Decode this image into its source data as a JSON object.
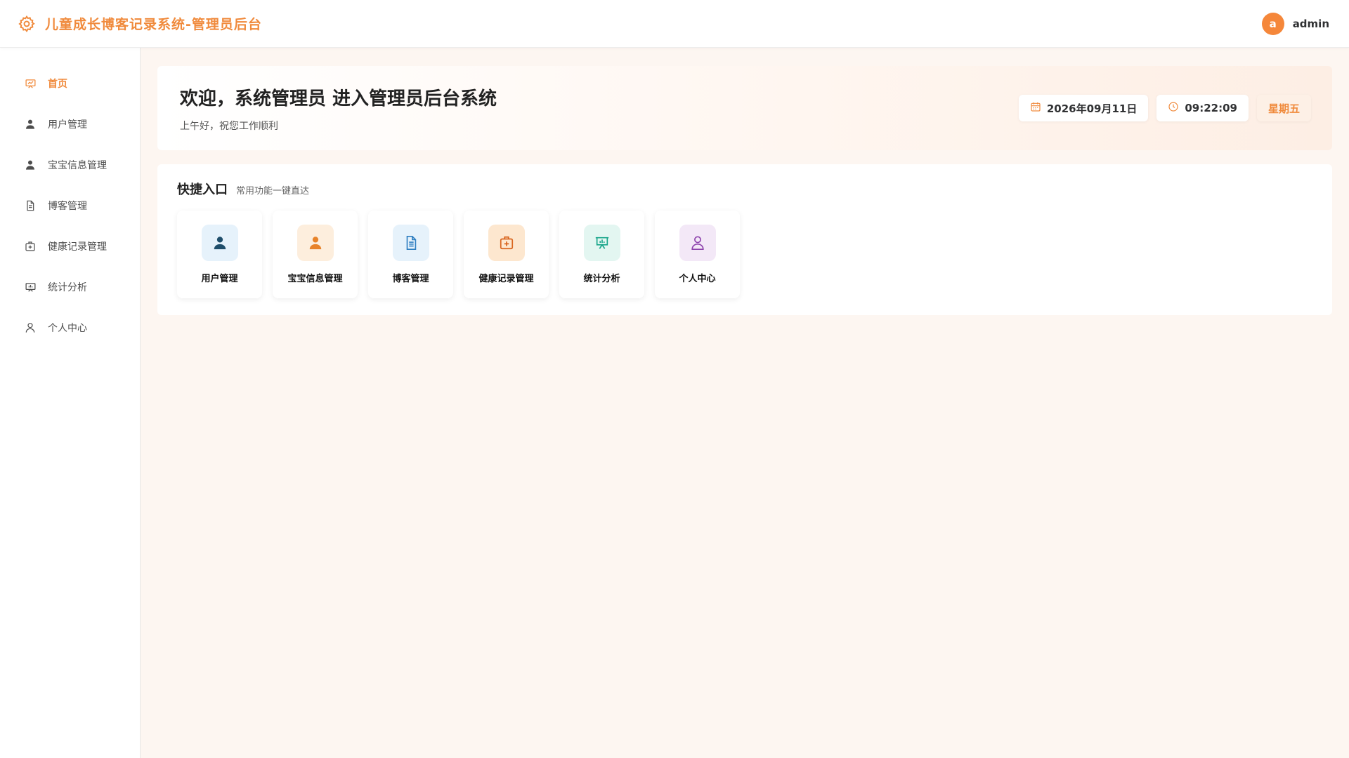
{
  "header": {
    "title": "儿童成长博客记录系统-管理员后台",
    "brand_icon": "gear-icon",
    "avatar_letter": "a",
    "username": "admin",
    "accent": "#f08a3c"
  },
  "sidebar": {
    "items": [
      {
        "label": "首页",
        "icon": "presentation-icon",
        "active": true
      },
      {
        "label": "用户管理",
        "icon": "user-icon"
      },
      {
        "label": "宝宝信息管理",
        "icon": "user-icon"
      },
      {
        "label": "博客管理",
        "icon": "document-icon"
      },
      {
        "label": "健康记录管理",
        "icon": "medical-kit-icon"
      },
      {
        "label": "统计分析",
        "icon": "presentation-chart-icon"
      },
      {
        "label": "个人中心",
        "icon": "user-outline-icon"
      }
    ]
  },
  "welcome": {
    "title": "欢迎，系统管理员 进入管理员后台系统",
    "subtitle": "上午好，祝您工作顺利",
    "date": "2026年09月11日",
    "time": "09:22:09",
    "weekday": "星期五"
  },
  "quick": {
    "title": "快捷入口",
    "subtitle": "常用功能一键直达",
    "cards": [
      {
        "label": "用户管理",
        "icon": "user-icon",
        "bg": "#e6f2fb",
        "fg": "#1f4e6b"
      },
      {
        "label": "宝宝信息管理",
        "icon": "user-icon",
        "bg": "#fdeedd",
        "fg": "#e8832a"
      },
      {
        "label": "博客管理",
        "icon": "document-icon",
        "bg": "#e6f2fb",
        "fg": "#2f7fc1"
      },
      {
        "label": "健康记录管理",
        "icon": "medical-kit-icon",
        "bg": "#fde7cf",
        "fg": "#d9661f"
      },
      {
        "label": "统计分析",
        "icon": "presentation-chart-icon",
        "bg": "#e3f6f1",
        "fg": "#18a58a"
      },
      {
        "label": "个人中心",
        "icon": "user-outline-icon",
        "bg": "#f3e8f7",
        "fg": "#8e44ad"
      }
    ]
  }
}
